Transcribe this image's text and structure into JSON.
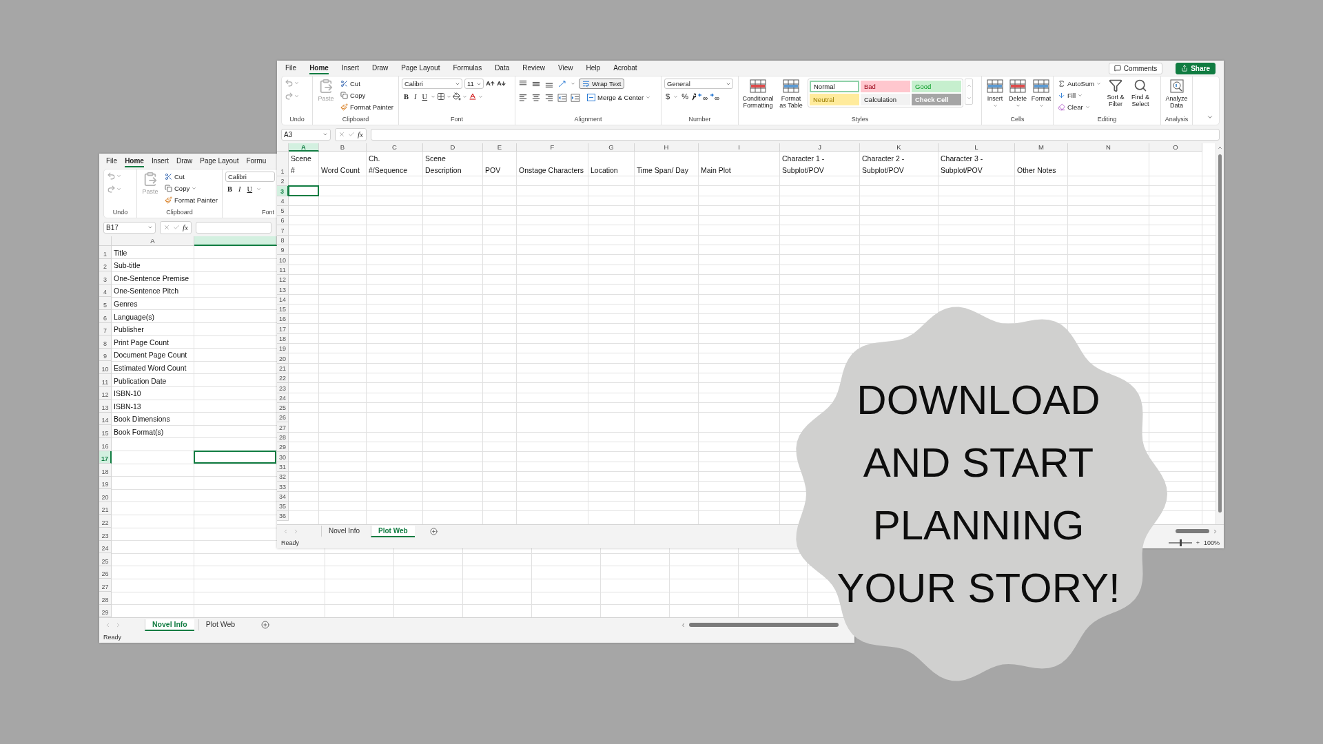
{
  "back_window": {
    "menu": [
      {
        "label": "File",
        "selected": false
      },
      {
        "label": "Home",
        "selected": true
      },
      {
        "label": "Insert",
        "selected": false
      },
      {
        "label": "Draw",
        "selected": false
      },
      {
        "label": "Page Layout",
        "selected": false
      },
      {
        "label": "Formu",
        "selected": false
      }
    ],
    "ribbon": {
      "undo_label": "Undo",
      "clipboard": {
        "label": "Clipboard",
        "paste": "Paste",
        "cut": "Cut",
        "copy": "Copy",
        "format_painter": "Format Painter"
      },
      "font": {
        "label": "Font",
        "name": "Calibri",
        "bold": "B",
        "italic": "I",
        "underline": "U"
      }
    },
    "name_box": "B17",
    "formula_icon": "fx",
    "column_header": "A",
    "rows": [
      {
        "number": "1",
        "label": "Title",
        "selected": false
      },
      {
        "number": "2",
        "label": "Sub-title",
        "selected": false
      },
      {
        "number": "3",
        "label": "One-Sentence Premise",
        "selected": false
      },
      {
        "number": "4",
        "label": "One-Sentence Pitch",
        "selected": false
      },
      {
        "number": "5",
        "label": "Genres",
        "selected": false
      },
      {
        "number": "6",
        "label": "Language(s)",
        "selected": false
      },
      {
        "number": "7",
        "label": "Publisher",
        "selected": false
      },
      {
        "number": "8",
        "label": "Print Page Count",
        "selected": false
      },
      {
        "number": "9",
        "label": "Document Page Count",
        "selected": false
      },
      {
        "number": "10",
        "label": "Estimated Word Count",
        "selected": false
      },
      {
        "number": "11",
        "label": "Publication Date",
        "selected": false
      },
      {
        "number": "12",
        "label": "ISBN-10",
        "selected": false
      },
      {
        "number": "13",
        "label": "ISBN-13",
        "selected": false
      },
      {
        "number": "14",
        "label": "Book Dimensions",
        "selected": false
      },
      {
        "number": "15",
        "label": "Book Format(s)",
        "selected": false
      },
      {
        "number": "16",
        "selected": false
      },
      {
        "number": "17",
        "selected": true
      },
      {
        "number": "18",
        "selected": false
      },
      {
        "number": "19",
        "selected": false
      },
      {
        "number": "20",
        "selected": false
      },
      {
        "number": "21",
        "selected": false
      },
      {
        "number": "22",
        "selected": false
      },
      {
        "number": "23",
        "selected": false
      },
      {
        "number": "24",
        "selected": false
      },
      {
        "number": "25",
        "selected": false
      },
      {
        "number": "26",
        "selected": false
      },
      {
        "number": "27",
        "selected": false
      },
      {
        "number": "28",
        "selected": false
      },
      {
        "number": "29",
        "selected": false
      }
    ],
    "sheet_tabs": [
      {
        "label": "Novel Info",
        "selected": true
      },
      {
        "label": "Plot Web",
        "selected": false
      }
    ],
    "status": "Ready"
  },
  "front_window": {
    "menu": [
      {
        "label": "File",
        "selected": false
      },
      {
        "label": "Home",
        "selected": true
      },
      {
        "label": "Insert",
        "selected": false
      },
      {
        "label": "Draw",
        "selected": false
      },
      {
        "label": "Page Layout",
        "selected": false
      },
      {
        "label": "Formulas",
        "selected": false
      },
      {
        "label": "Data",
        "selected": false
      },
      {
        "label": "Review",
        "selected": false
      },
      {
        "label": "View",
        "selected": false
      },
      {
        "label": "Help",
        "selected": false
      },
      {
        "label": "Acrobat",
        "selected": false
      }
    ],
    "comments": "Comments",
    "share": "Share",
    "ribbon": {
      "undo": {
        "label": "Undo"
      },
      "clipboard": {
        "label": "Clipboard",
        "paste": "Paste",
        "paste_disabled": true,
        "cut": "Cut",
        "copy": "Copy",
        "format_painter": "Format Painter"
      },
      "font": {
        "label": "Font",
        "name": "Calibri",
        "size": "11",
        "bold": "B",
        "italic": "I",
        "underline": "U"
      },
      "alignment": {
        "label": "Alignment",
        "wrap_text": "Wrap Text",
        "merge": "Merge & Center"
      },
      "number": {
        "label": "Number",
        "format": "General",
        "currency": "$",
        "percent": "%"
      },
      "styles": {
        "label": "Styles",
        "conditional": "Conditional Formatting",
        "format_table": "Format as Table",
        "gallery": [
          {
            "label": "Normal",
            "color": "#ffffff"
          },
          {
            "label": "Bad",
            "color": "#ffc7ce"
          },
          {
            "label": "Good",
            "color": "#c6efce"
          },
          {
            "label": "Neutral",
            "color": "#ffeb9c"
          },
          {
            "label": "Calculation",
            "color": "#f2f2f2"
          },
          {
            "label": "Check Cell",
            "color": "#a5a5a5"
          }
        ]
      },
      "cells": {
        "label": "Cells",
        "insert": "Insert",
        "delete": "Delete",
        "format": "Format"
      },
      "editing": {
        "label": "Editing",
        "autosum": "AutoSum",
        "fill": "Fill",
        "clear": "Clear",
        "sort": "Sort & Filter",
        "find": "Find & Select"
      },
      "analysis": {
        "label": "Analysis",
        "analyze": "Analyze Data"
      }
    },
    "name_box": "A3",
    "formula_icon": "fx",
    "columns": [
      {
        "label": "A",
        "selected": true
      },
      {
        "label": "B",
        "selected": false
      },
      {
        "label": "C",
        "selected": false
      },
      {
        "label": "D",
        "selected": false
      },
      {
        "label": "E",
        "selected": false
      },
      {
        "label": "F",
        "selected": false
      },
      {
        "label": "G",
        "selected": false
      },
      {
        "label": "H",
        "selected": false
      },
      {
        "label": "I",
        "selected": false
      },
      {
        "label": "J",
        "selected": false
      },
      {
        "label": "K",
        "selected": false
      },
      {
        "label": "L",
        "selected": false
      },
      {
        "label": "M",
        "selected": false
      },
      {
        "label": "N",
        "selected": false
      },
      {
        "label": "O",
        "selected": false
      }
    ],
    "header_row": {
      "number": "1",
      "cells": [
        [
          "Scene",
          "#"
        ],
        [
          "Word Count"
        ],
        [
          "Ch.",
          "#/Sequence"
        ],
        [
          "Scene",
          "Description"
        ],
        [
          "POV"
        ],
        [
          "Onstage Characters"
        ],
        [
          "Location"
        ],
        [
          "Time Span/ Day"
        ],
        [
          "Main Plot"
        ],
        [
          "Character 1 -",
          "Subplot/POV"
        ],
        [
          "Character 2 -",
          "Subplot/POV"
        ],
        [
          "Character 3 -",
          "Subplot/POV"
        ],
        [
          "Other Notes"
        ]
      ]
    },
    "rows": [
      {
        "number": "2",
        "selected": false
      },
      {
        "number": "3",
        "selected": true
      },
      {
        "number": "4",
        "selected": false
      },
      {
        "number": "5",
        "selected": false
      },
      {
        "number": "6",
        "selected": false
      },
      {
        "number": "7",
        "selected": false
      },
      {
        "number": "8",
        "selected": false
      },
      {
        "number": "9",
        "selected": false
      },
      {
        "number": "10",
        "selected": false
      },
      {
        "number": "11",
        "selected": false
      },
      {
        "number": "12",
        "selected": false
      },
      {
        "number": "13",
        "selected": false
      },
      {
        "number": "14",
        "selected": false
      },
      {
        "number": "15",
        "selected": false
      },
      {
        "number": "16",
        "selected": false
      },
      {
        "number": "17",
        "selected": false
      },
      {
        "number": "18",
        "selected": false
      },
      {
        "number": "19",
        "selected": false
      },
      {
        "number": "20",
        "selected": false
      },
      {
        "number": "21",
        "selected": false
      },
      {
        "number": "22",
        "selected": false
      },
      {
        "number": "23",
        "selected": false
      },
      {
        "number": "24",
        "selected": false
      },
      {
        "number": "25",
        "selected": false
      },
      {
        "number": "26",
        "selected": false
      },
      {
        "number": "27",
        "selected": false
      },
      {
        "number": "28",
        "selected": false
      },
      {
        "number": "29",
        "selected": false
      },
      {
        "number": "30",
        "selected": false
      },
      {
        "number": "31",
        "selected": false
      },
      {
        "number": "32",
        "selected": false
      },
      {
        "number": "33",
        "selected": false
      },
      {
        "number": "34",
        "selected": false
      },
      {
        "number": "35",
        "selected": false
      },
      {
        "number": "36",
        "selected": false
      }
    ],
    "sheet_tabs": [
      {
        "label": "Novel Info",
        "selected": false
      },
      {
        "label": "Plot Web",
        "selected": true
      }
    ],
    "status": "Ready",
    "zoom_slider": {
      "level": 0.5
    },
    "zoom_plus": "+",
    "zoom": "100%"
  },
  "banner": {
    "lines": [
      "DOWNLOAD",
      "AND START",
      "PLANNING",
      "YOUR STORY!"
    ]
  }
}
